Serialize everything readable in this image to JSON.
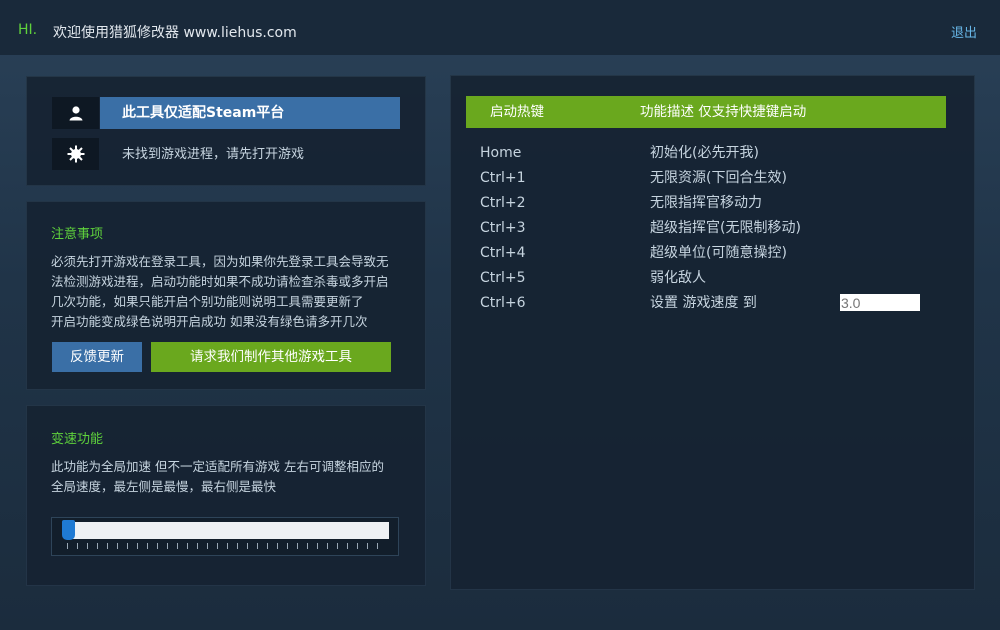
{
  "header": {
    "hi": "HI.",
    "title": "欢迎使用猎狐修改器 www.liehus.com",
    "logout": "退出"
  },
  "steam_panel": {
    "platform_label": "此工具仅适配Steam平台",
    "process_status": "未找到游戏进程，请先打开游戏",
    "icons": [
      "user-icon",
      "gear-icon"
    ]
  },
  "notice": {
    "title": "注意事项",
    "lines": [
      "必须先打开游戏在登录工具，因为如果你先登录工具会导致无",
      "法检测游戏进程，启动功能时如果不成功请检查杀毒或多开启",
      "几次功能，如果只能开启个别功能则说明工具需要更新了",
      "开启功能变成绿色说明开启成功 如果没有绿色请多开几次"
    ],
    "feedback_button": "反馈更新",
    "request_button": "请求我们制作其他游戏工具"
  },
  "speed": {
    "title": "变速功能",
    "lines": [
      "此功能为全局加速 但不一定适配所有游戏 左右可调整相应的",
      "全局速度，最左侧是最慢，最右侧是最快"
    ],
    "slider_value": 0
  },
  "hotkeys": {
    "header_key": "启动热键",
    "header_desc": "功能描述 仅支持快捷键启动",
    "rows": [
      {
        "key": "Home",
        "desc": "初始化(必先开我)"
      },
      {
        "key": "Ctrl+1",
        "desc": "无限资源(下回合生效)"
      },
      {
        "key": "Ctrl+2",
        "desc": "无限指挥官移动力"
      },
      {
        "key": "Ctrl+3",
        "desc": "超级指挥官(无限制移动)"
      },
      {
        "key": "Ctrl+4",
        "desc": "超级单位(可随意操控)"
      },
      {
        "key": "Ctrl+5",
        "desc": "弱化敌人"
      },
      {
        "key": "Ctrl+6",
        "desc": "设置 游戏速度 到"
      }
    ],
    "speed_input_placeholder": "3.0"
  },
  "colors": {
    "accent_green": "#6aa81e",
    "title_green": "#5fd23c",
    "accent_blue": "#3a6fa6",
    "link_blue": "#67b6e7"
  }
}
